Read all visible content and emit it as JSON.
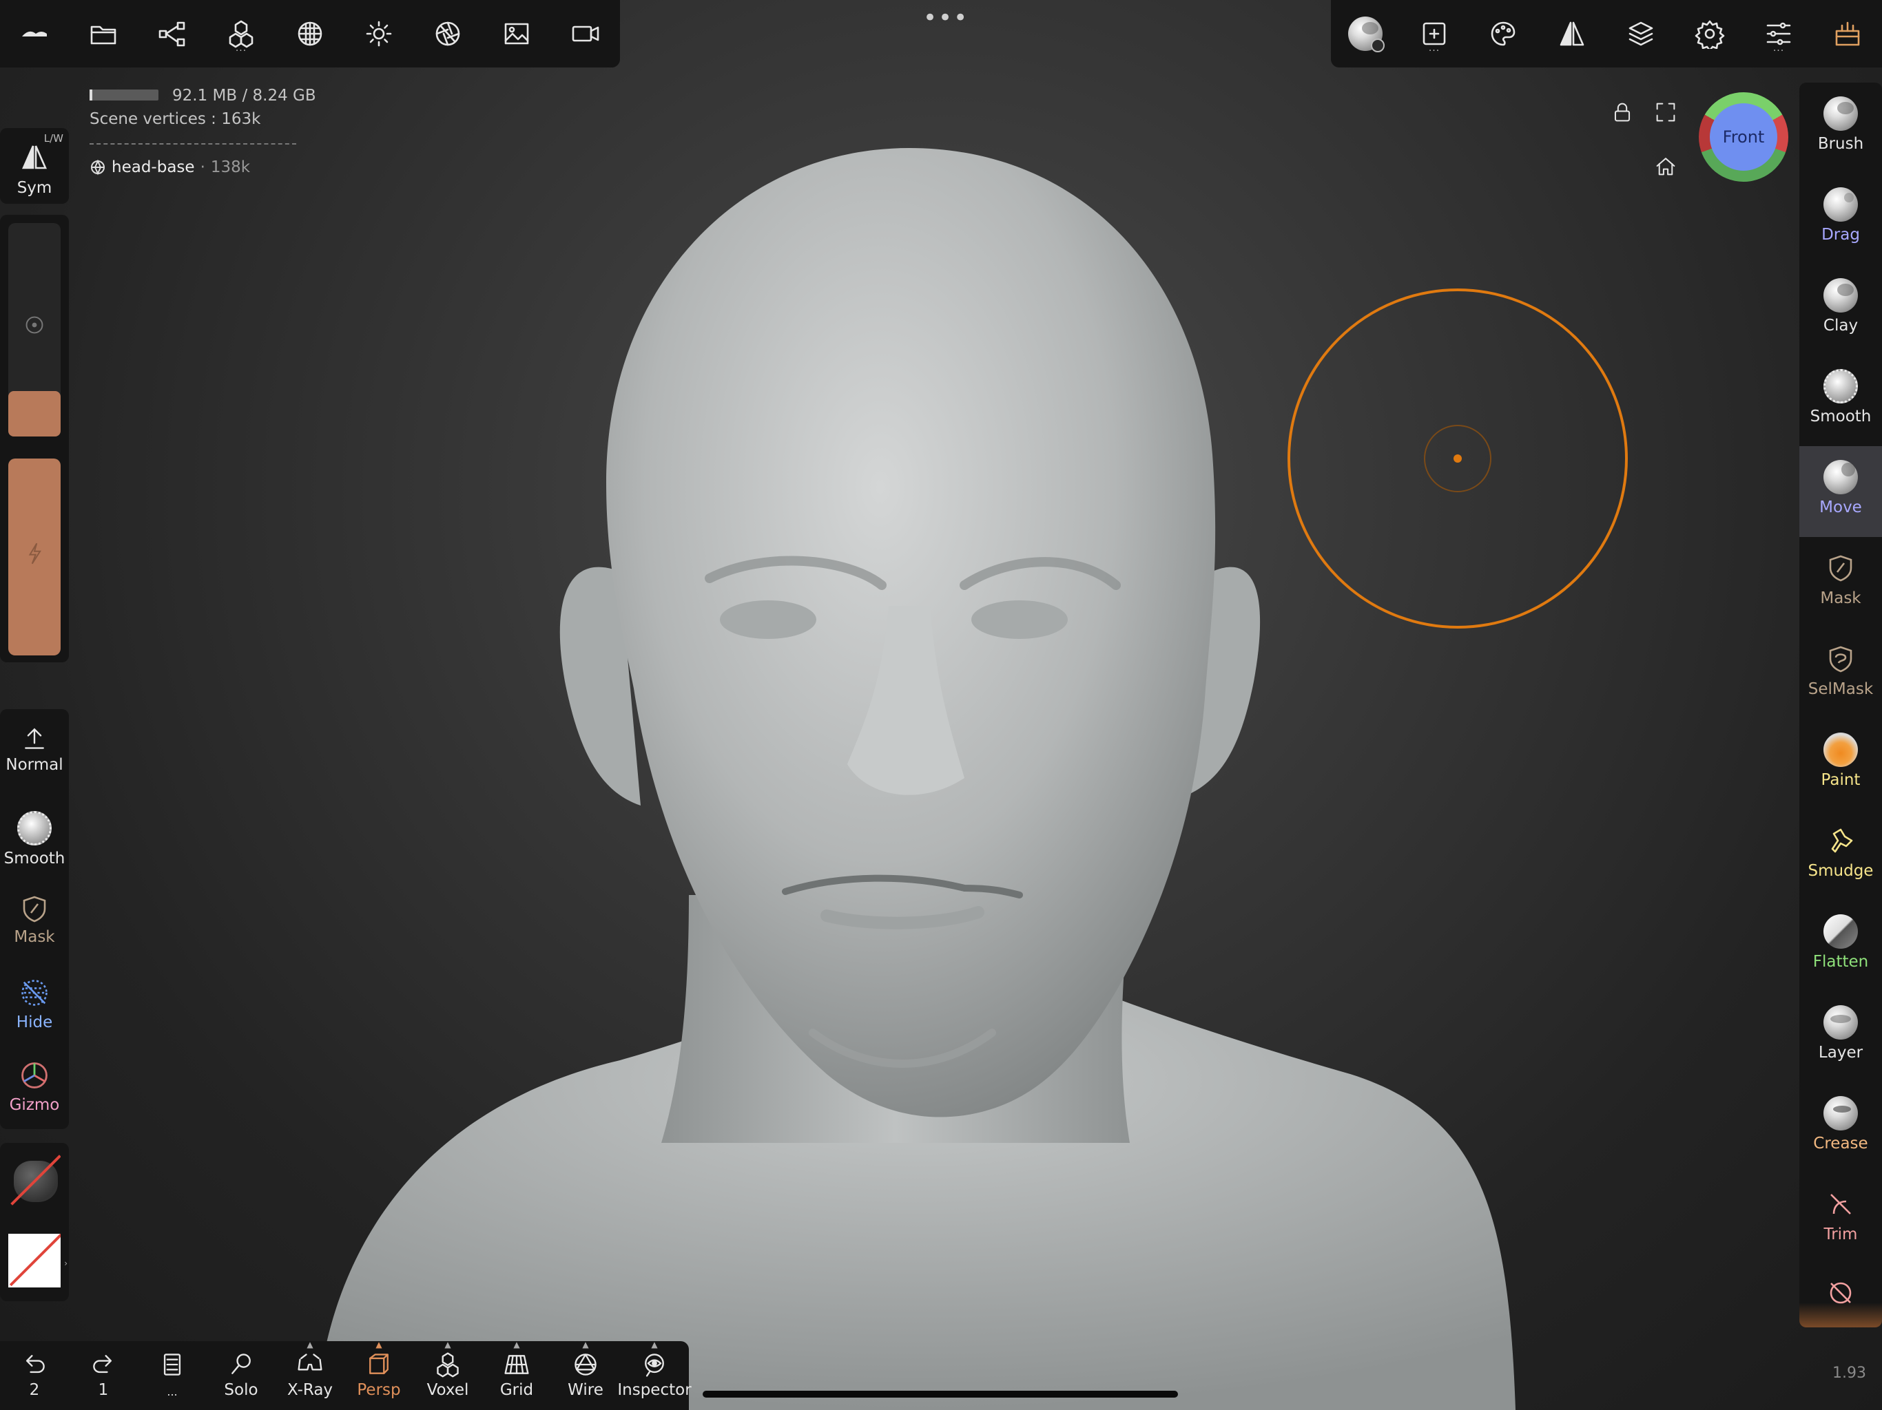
{
  "top_bar": {
    "more_dots": "•••"
  },
  "info": {
    "memory": "92.1 MB / 8.24 GB",
    "vertices_label": "Scene vertices :",
    "vertices_value": "163k",
    "object_name": "head-base",
    "object_sep": "·",
    "object_verts": "138k"
  },
  "left_toolbar": {
    "sym_label": "Sym",
    "sym_corner": "L/W",
    "normal_label": "Normal",
    "smooth_label": "Smooth",
    "mask_label": "Mask",
    "hide_label": "Hide",
    "gizmo_label": "Gizmo"
  },
  "right_tools": [
    {
      "label": "Brush",
      "color": "#e6e6e6"
    },
    {
      "label": "Drag",
      "color": "#a8a8ff"
    },
    {
      "label": "Clay",
      "color": "#e6e6e6"
    },
    {
      "label": "Smooth",
      "color": "#e6e6e6"
    },
    {
      "label": "Move",
      "color": "#a8a8ff"
    },
    {
      "label": "Mask",
      "color": "#b9a38a"
    },
    {
      "label": "SelMask",
      "color": "#b9a38a"
    },
    {
      "label": "Paint",
      "color": "#f6e48a"
    },
    {
      "label": "Smudge",
      "color": "#f6e48a"
    },
    {
      "label": "Flatten",
      "color": "#8ee07a"
    },
    {
      "label": "Layer",
      "color": "#e6e6e6"
    },
    {
      "label": "Crease",
      "color": "#f2b880"
    },
    {
      "label": "Trim",
      "color": "#f2a0a0"
    }
  ],
  "view_cube": {
    "label": "Front"
  },
  "bottom_bar": {
    "undo_count": "2",
    "redo_count": "1",
    "more": "...",
    "solo": "Solo",
    "xray": "X-Ray",
    "persp": "Persp",
    "voxel": "Voxel",
    "grid": "Grid",
    "wire": "Wire",
    "inspector": "Inspector"
  },
  "version": "1.93",
  "colors": {
    "accent_orange": "#e07a10",
    "material_swatch": "#b87a5a",
    "panel_bg": "#151515"
  }
}
